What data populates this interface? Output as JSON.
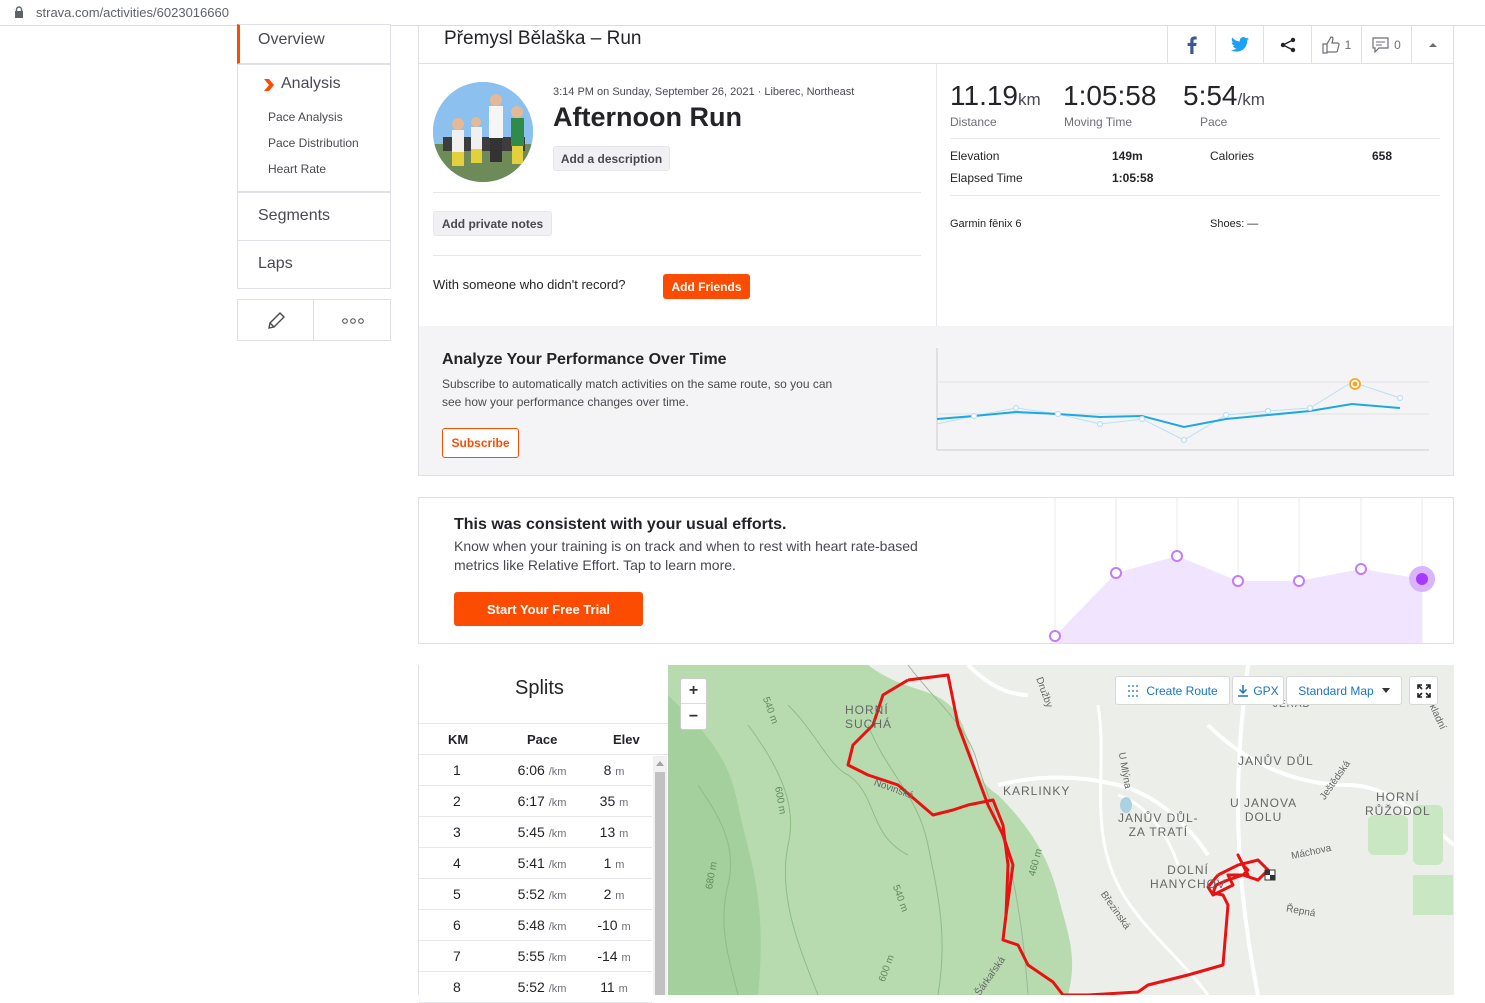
{
  "browser": {
    "url": "strava.com/activities/6023016660"
  },
  "sidebar": {
    "overview": "Overview",
    "analysis": "Analysis",
    "sub_items": [
      "Pace Analysis",
      "Pace Distribution",
      "Heart Rate"
    ],
    "segments": "Segments",
    "laps": "Laps"
  },
  "header": {
    "title": "Přemysl Bělaška – Run",
    "kudos_count": "1",
    "comment_count": "0"
  },
  "activity": {
    "meta": "3:14 PM on Sunday, September 26, 2021 · Liberec, Northeast",
    "name": "Afternoon Run",
    "add_description": "Add a description",
    "add_private_notes": "Add private notes",
    "with_someone": "With someone who didn't record?",
    "add_friends": "Add Friends"
  },
  "stats": {
    "distance": {
      "value": "11.19",
      "unit": "km",
      "label": "Distance"
    },
    "moving_time": {
      "value": "1:05:58",
      "label": "Moving Time"
    },
    "pace": {
      "value": "5:54",
      "unit": "/km",
      "label": "Pace"
    },
    "elevation_label": "Elevation",
    "elevation_value": "149m",
    "calories_label": "Calories",
    "calories_value": "658",
    "elapsed_label": "Elapsed Time",
    "elapsed_value": "1:05:58",
    "device": "Garmin fēnix 6",
    "shoes": "Shoes: —"
  },
  "performance": {
    "title": "Analyze Your Performance Over Time",
    "desc_line1": "Subscribe to automatically match activities on the same route, so you can",
    "desc_line2": "see how your performance changes over time.",
    "button": "Subscribe",
    "accent": "#1fa8e0"
  },
  "effort": {
    "title": "This was consistent with your usual efforts.",
    "desc_line1": "Know when your training is on track and when to rest with heart rate-based",
    "desc_line2": "metrics like Relative Effort. Tap to learn more.",
    "button": "Start Your Free Trial",
    "accent": "#c27bff"
  },
  "splits": {
    "title": "Splits",
    "headers": [
      "KM",
      "Pace",
      "Elev"
    ],
    "pace_unit": "/km",
    "elev_unit": "m",
    "rows": [
      {
        "km": "1",
        "pace": "6:06",
        "elev": "8"
      },
      {
        "km": "2",
        "pace": "6:17",
        "elev": "35"
      },
      {
        "km": "3",
        "pace": "5:45",
        "elev": "13"
      },
      {
        "km": "4",
        "pace": "5:41",
        "elev": "1"
      },
      {
        "km": "5",
        "pace": "5:52",
        "elev": "2"
      },
      {
        "km": "6",
        "pace": "5:48",
        "elev": "-10"
      },
      {
        "km": "7",
        "pace": "5:55",
        "elev": "-14"
      },
      {
        "km": "8",
        "pace": "5:52",
        "elev": "11"
      }
    ]
  },
  "map": {
    "zoom_in": "+",
    "zoom_out": "−",
    "create_route": "Create Route",
    "gpx": "GPX",
    "map_type": "Standard Map",
    "labels": {
      "horni_sucha": "HORNÍ\nSUCHÁ",
      "karlinky": "KARLINKY",
      "januv_dul": "JANŮV DŮL",
      "u_janova_dolu": "U JANOVA\nDOLU",
      "januv_dul_za_trati": "JANŮV DŮL-\nZA TRATÍ",
      "dolni_hanychov": "DOLNÍ\nHANYCHOV",
      "horni_ruzodol": "HORNÍ\nRŮŽODOL",
      "machova": "Máchova",
      "repna": "Řepná",
      "druzby": "Družby",
      "u_mlyna": "U Mlýna",
      "novinska": "Novinská",
      "jestedska": "Ještědská",
      "brezinska": "Březinská",
      "sarkarska": "Šárkařská",
      "okladni": "okladní",
      "jerad": "JERAD",
      "c540a": "540 m",
      "c600a": "600 m",
      "c680": "680 m",
      "c540b": "540 m",
      "c600b": "600 m",
      "c460": "460 m"
    }
  }
}
